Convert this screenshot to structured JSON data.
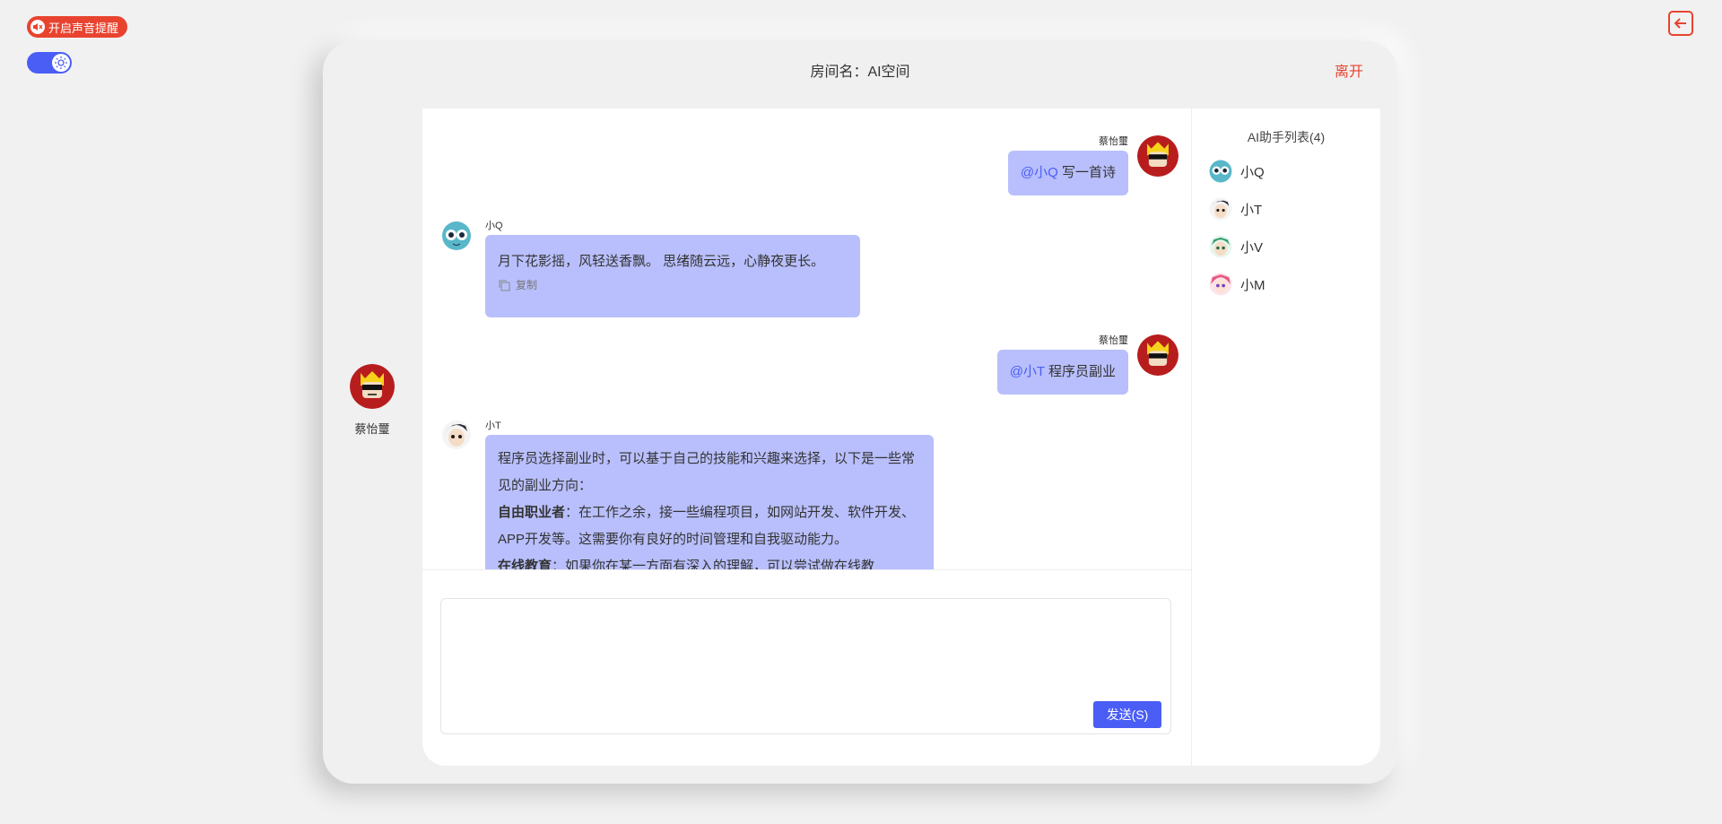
{
  "top": {
    "sound_label": "开启声音提醒"
  },
  "room": {
    "title": "房间名：AI空间",
    "leave_label": "离开"
  },
  "current_user": {
    "name": "蔡怡璽"
  },
  "messages": [
    {
      "sender": "蔡怡璽",
      "mention": "@小Q",
      "text": " 写一首诗"
    },
    {
      "sender": "小Q",
      "text": "月下花影摇，风轻送香飘。 思绪随云远，心静夜更长。",
      "copy_label": "复制"
    },
    {
      "sender": "蔡怡璽",
      "mention": "@小T",
      "text": " 程序员副业"
    },
    {
      "sender": "小T",
      "intro": "程序员选择副业时，可以基于自己的技能和兴趣来选择，以下是一些常见的副业方向：",
      "item1_title": "自由职业者",
      "item1_text": "：在工作之余，接一些编程项目，如网站开发、软件开发、APP开发等。这需要你有良好的时间管理和自我驱动能力。",
      "item2_title": "在线教育",
      "item2_text": "：如果你在某一方面有深入的理解，可以尝试做在线教"
    }
  ],
  "composer": {
    "value": "",
    "send_label": "发送(S)"
  },
  "ai_list": {
    "title": "AI助手列表(4)",
    "items": [
      {
        "name": "小Q"
      },
      {
        "name": "小T"
      },
      {
        "name": "小V"
      },
      {
        "name": "小M"
      }
    ]
  },
  "colors": {
    "accent": "#4a5ef5",
    "danger": "#e8432f",
    "bubble": "#b8bffc"
  }
}
